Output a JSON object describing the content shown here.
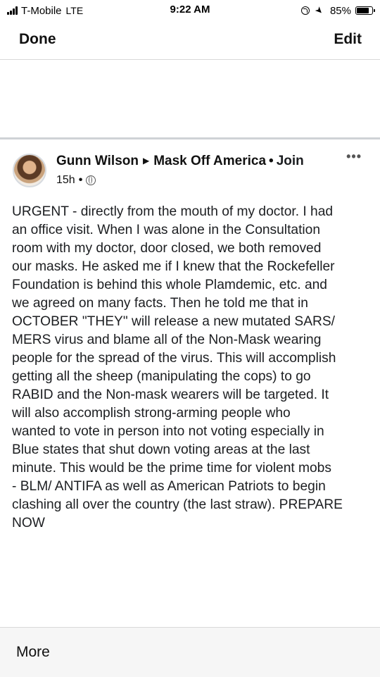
{
  "status_bar": {
    "carrier": "T-Mobile",
    "network": "LTE",
    "time": "9:22 AM",
    "battery_percent": "85%",
    "battery_level": 0.85
  },
  "nav": {
    "done_label": "Done",
    "edit_label": "Edit"
  },
  "post": {
    "author": "Gunn Wilson",
    "group": "Mask Off America",
    "separator": "•",
    "join_label": "Join",
    "timestamp": "15h",
    "more_glyph": "•••",
    "body": "URGENT - directly from the mouth of my doctor. I had\nan office visit. When I was alone in the Consultation\nroom with my doctor, door closed, we both removed\nour masks. He asked me if I knew that the Rockefeller\nFoundation is behind this whole Plamdemic, etc. and\nwe agreed on many facts. Then he told me that in\nOCTOBER \"THEY\" will release a new mutated SARS/\nMERS virus and blame all of the Non-Mask wearing\npeople for the spread of the virus. This will accomplish\ngetting all the sheep (manipulating the cops) to go\nRABID and the Non-mask wearers will be targeted. It\nwill also accomplish strong-arming people who\nwanted to vote in person into not voting especially in\nBlue states that shut down voting areas at the last\nminute. This would be the prime time for violent mobs\n- BLM/ ANTIFA as well as American Patriots to begin\nclashing all over the country (the last straw). PREPARE\nNOW"
  },
  "bottom": {
    "more_label": "More"
  },
  "icons": {
    "avatar": "avatar",
    "arrow": "triangle-right-icon",
    "globe": "globe-icon",
    "more": "more-options-icon"
  }
}
